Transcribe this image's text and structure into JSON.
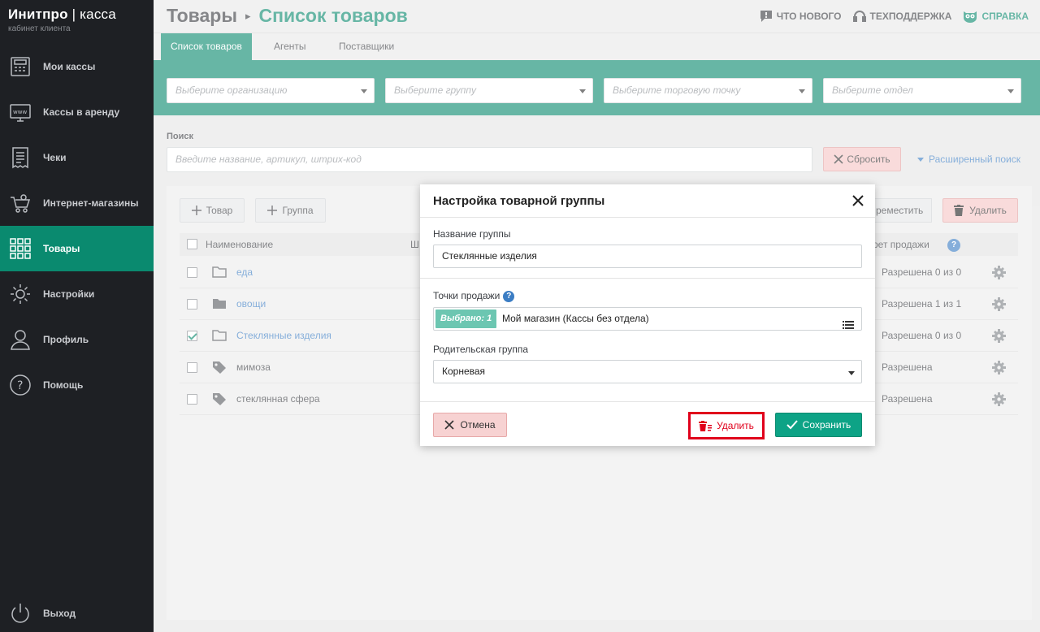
{
  "brand": {
    "name_bold": "Инитпро",
    "name_sep": " | ",
    "name_light": "касса",
    "subtitle": "кабинет клиента"
  },
  "colors": {
    "accent": "#0a8a6f",
    "sidebar_bg": "#1e2024",
    "link": "#3b7dc4",
    "danger": "#e0001b"
  },
  "sidebar": {
    "items": [
      {
        "label": "Мои кассы",
        "icon": "cash-register-icon"
      },
      {
        "label": "Кассы в аренду",
        "icon": "monitor-www-icon"
      },
      {
        "label": "Чеки",
        "icon": "receipt-icon"
      },
      {
        "label": "Интернет-магазины",
        "icon": "online-cart-icon"
      },
      {
        "label": "Товары",
        "icon": "grid-icon",
        "active": true
      },
      {
        "label": "Настройки",
        "icon": "gear-icon"
      },
      {
        "label": "Профиль",
        "icon": "user-icon"
      },
      {
        "label": "Помощь",
        "icon": "question-icon"
      }
    ],
    "logout_label": "Выход"
  },
  "header": {
    "breadcrumb_root": "Товары",
    "breadcrumb_current": "Список товаров",
    "links": {
      "whats_new": "Что нового",
      "support": "Техподдержка",
      "help": "Справка"
    }
  },
  "tabs": [
    "Список товаров",
    "Агенты",
    "Поставщики"
  ],
  "filters": {
    "organization": "Выберите организацию",
    "group": "Выберите группу",
    "point": "Выберите торговую точку",
    "department": "Выберите отдел"
  },
  "search": {
    "label": "Поиск",
    "placeholder": "Введите название, артикул, штрих-код",
    "reset": "Сбросить",
    "advanced": "Расширенный поиск"
  },
  "toolbar": {
    "add_product": "Товар",
    "add_group": "Группа",
    "move": "реместить",
    "delete": "Удалить"
  },
  "table": {
    "col_name": "Наименование",
    "col_partial": "Ш",
    "col_sale": "рет продажи",
    "rows": [
      {
        "name": "еда",
        "type": "folder",
        "checked": false,
        "permission": "Разрешена 0 из 0"
      },
      {
        "name": "овощи",
        "type": "folder-filled",
        "checked": false,
        "permission": "Разрешена 1 из 1"
      },
      {
        "name": "Стеклянные изделия",
        "type": "folder",
        "checked": true,
        "permission": "Разрешена 0 из 0"
      },
      {
        "name": "мимоза",
        "type": "tag",
        "checked": false,
        "permission": "Разрешена"
      },
      {
        "name": "стеклянная сфера",
        "type": "tag",
        "checked": false,
        "permission": "Разрешена"
      }
    ]
  },
  "modal": {
    "title": "Настройка товарной группы",
    "group_name_label": "Название группы",
    "group_name_value": "Стеклянные изделия",
    "sale_points_label": "Точки продажи",
    "selected_chip": "Выбрано: 1",
    "sale_points_value": "Мой магазин (Кассы без отдела)",
    "parent_label": "Родительская группа",
    "parent_value": "Корневая",
    "cancel": "Отмена",
    "delete": "Удалить",
    "save": "Сохранить"
  }
}
